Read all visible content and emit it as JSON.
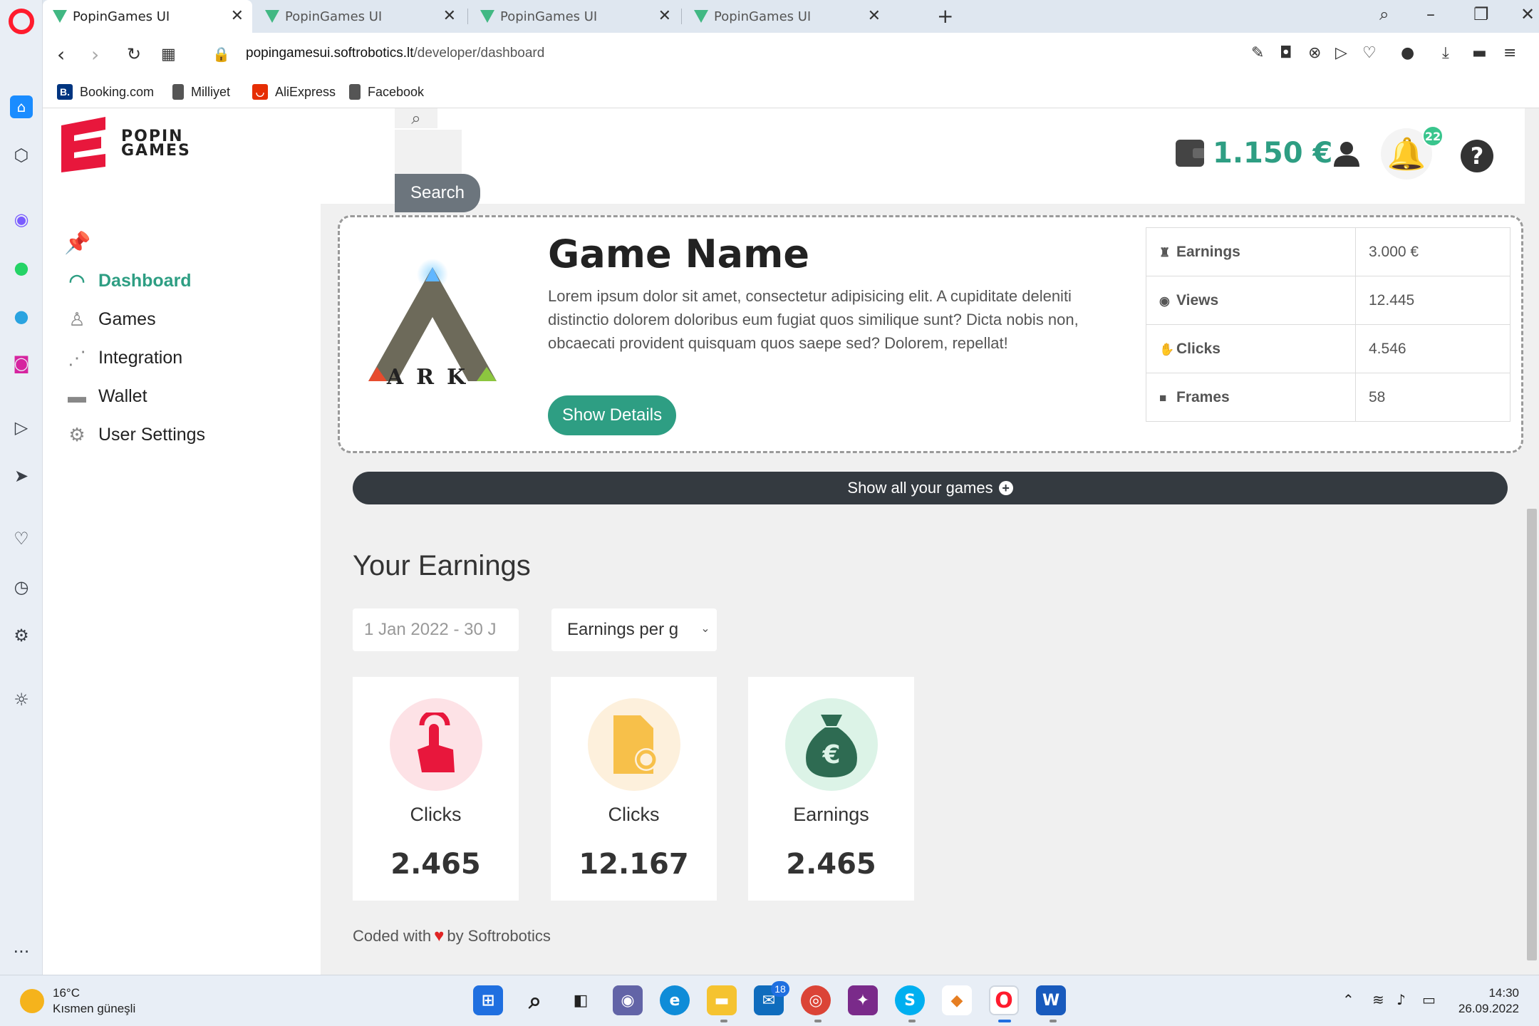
{
  "browser": {
    "tabs": [
      {
        "title": "PopinGames UI",
        "active": true
      },
      {
        "title": "PopinGames UI",
        "active": false
      },
      {
        "title": "PopinGames UI",
        "active": false
      },
      {
        "title": "PopinGames UI",
        "active": false
      }
    ],
    "url_host": "popingamesui.softrobotics.lt",
    "url_path": "/developer/dashboard",
    "bookmarks": [
      {
        "label": "Booking.com",
        "icon": "B."
      },
      {
        "label": "Milliyet",
        "icon": "page"
      },
      {
        "label": "AliExpress",
        "icon": "aliexpress"
      },
      {
        "label": "Facebook",
        "icon": "page"
      }
    ]
  },
  "sidebar": {
    "brand": "POPIN GAMES",
    "brand_line1": "POPIN",
    "brand_line2": "GAMES",
    "items": [
      {
        "label": "Dashboard",
        "icon": "gauge-icon",
        "active": true
      },
      {
        "label": "Games",
        "icon": "joystick-icon",
        "active": false
      },
      {
        "label": "Integration",
        "icon": "share-nodes-icon",
        "active": false
      },
      {
        "label": "Wallet",
        "icon": "wallet-icon",
        "active": false
      },
      {
        "label": "User Settings",
        "icon": "gears-icon",
        "active": false
      }
    ]
  },
  "header": {
    "search_label": "Search",
    "wallet_amount": "1.150 €",
    "notification_count": "22",
    "help": "?"
  },
  "game": {
    "title": "Game Name",
    "description": "Lorem ipsum dolor sit amet, consectetur adipisicing elit. A cupiditate deleniti distinctio dolorem doloribus eum fugiat quos similique sunt? Dicta nobis non, obcaecati provident quisquam quos saepe sed? Dolorem, repellat!",
    "details_button": "Show Details",
    "logo_letters": "ARK",
    "stats": [
      {
        "key": "Earnings",
        "value": "3.000 €",
        "icon": "money-bag-icon"
      },
      {
        "key": "Views",
        "value": "12.445",
        "icon": "eye-icon"
      },
      {
        "key": "Clicks",
        "value": "4.546",
        "icon": "hand-icon"
      },
      {
        "key": "Frames",
        "value": "58",
        "icon": "square-icon"
      }
    ]
  },
  "show_all_label": "Show all your games",
  "earnings": {
    "title": "Your Earnings",
    "date_range": "1 Jan 2022 - 30 J",
    "select_value": "Earnings per g",
    "cards": [
      {
        "label": "Clicks",
        "value": "2.465",
        "icon": "tap-icon",
        "color": "#e8173c",
        "bg": "#fde2e6"
      },
      {
        "label": "Clicks",
        "value": "12.167",
        "icon": "file-icon",
        "color": "#f7c04a",
        "bg": "#fdf0dc"
      },
      {
        "label": "Earnings",
        "value": "2.465",
        "icon": "euro-bag-icon",
        "color": "#2e6b52",
        "bg": "#dcf3e7"
      }
    ]
  },
  "footer": {
    "before": "Coded with",
    "after": "by Softrobotics"
  },
  "taskbar": {
    "weather_temp": "16°C",
    "weather_desc": "Kısmen güneşli",
    "mail_badge": "18",
    "time": "14:30",
    "date": "26.09.2022"
  },
  "colors": {
    "accent": "#2e9e83",
    "dark": "#343a40",
    "tab_bg": "#dfe7f0"
  }
}
